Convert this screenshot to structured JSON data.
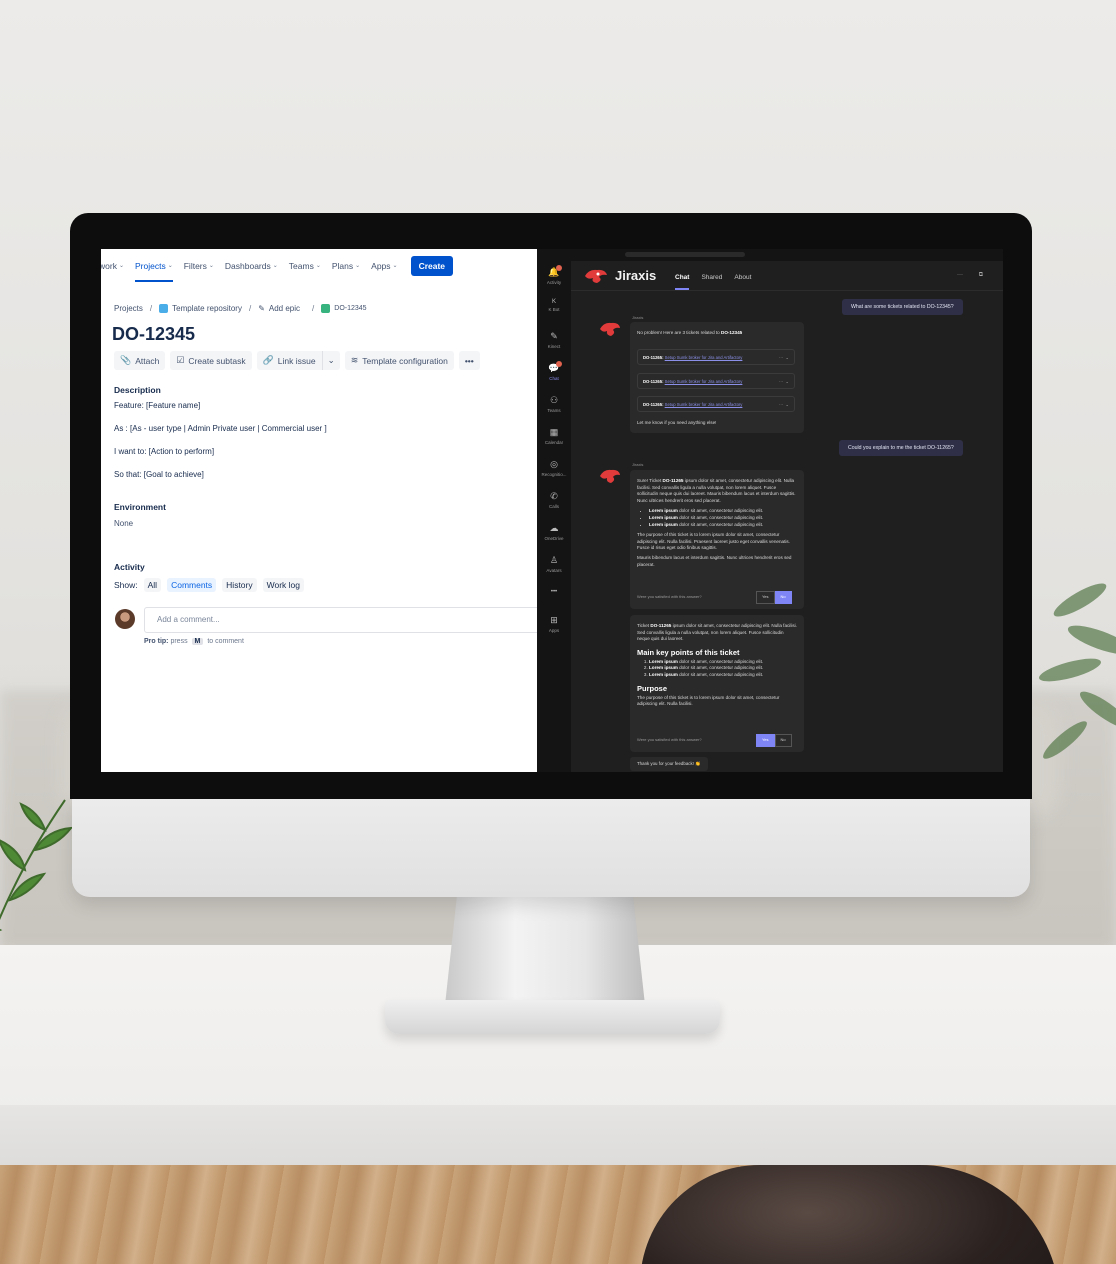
{
  "jira": {
    "nav": [
      {
        "label": "work",
        "active": false
      },
      {
        "label": "Projects",
        "active": true
      },
      {
        "label": "Filters",
        "active": false
      },
      {
        "label": "Dashboards",
        "active": false
      },
      {
        "label": "Teams",
        "active": false
      },
      {
        "label": "Plans",
        "active": false
      },
      {
        "label": "Apps",
        "active": false
      }
    ],
    "create_label": "Create",
    "breadcrumbs": [
      "Projects",
      "Template repository",
      "Add epic",
      "DO-12345"
    ],
    "issue_key": "DO-12345",
    "toolbar": {
      "attach": "Attach",
      "create_subtask": "Create subtask",
      "link_issue": "Link issue",
      "template_configuration": "Template configuration",
      "more": "•••"
    },
    "description": {
      "heading": "Description",
      "lines": [
        "Feature: [Feature name]",
        "As : [As - user type | Admin Private user | Commercial user ]",
        "I want to: [Action to perform]",
        "So that: [Goal to achieve]"
      ]
    },
    "environment": {
      "heading": "Environment",
      "value": "None"
    },
    "activity": {
      "heading": "Activity",
      "show_label": "Show:",
      "filters": [
        {
          "label": "All",
          "selected": false
        },
        {
          "label": "Comments",
          "selected": true
        },
        {
          "label": "History",
          "selected": false
        },
        {
          "label": "Work log",
          "selected": false
        }
      ]
    },
    "comment": {
      "placeholder": "Add a comment...",
      "protip_label": "Pro tip:",
      "protip_press": "press",
      "protip_key": "M",
      "protip_rest": "to comment"
    }
  },
  "teams": {
    "rail": [
      {
        "label": "Activity",
        "glyph": "🔔",
        "badge": true
      },
      {
        "label": "K Bot",
        "glyph": "K",
        "badge": false
      },
      {
        "label": "Kinect",
        "glyph": "✎",
        "badge": false
      },
      {
        "label": "Chat",
        "glyph": "💬",
        "badge": true,
        "active": true
      },
      {
        "label": "Teams",
        "glyph": "⚇",
        "badge": false
      },
      {
        "label": "Calendar",
        "glyph": "▦",
        "badge": false
      },
      {
        "label": "Recognitio...",
        "glyph": "◎",
        "badge": false
      },
      {
        "label": "Calls",
        "glyph": "✆",
        "badge": false
      },
      {
        "label": "OneDrive",
        "glyph": "☁",
        "badge": false
      },
      {
        "label": "Avatars",
        "glyph": "♙",
        "badge": false
      },
      {
        "label": "",
        "glyph": "•••",
        "badge": false
      },
      {
        "label": "Apps",
        "glyph": "⊞",
        "badge": false
      }
    ],
    "app_title": "Jiraxis",
    "tabs": [
      {
        "label": "Chat",
        "active": true
      },
      {
        "label": "Shared",
        "active": false
      },
      {
        "label": "About",
        "active": false
      }
    ],
    "window_controls": [
      "···",
      "⧉"
    ],
    "bot_name": "Jiraxis",
    "user_msg_1": "What are some tickets related to DO-12345?",
    "reply_1": {
      "intro": "No problem! Here are 3 tickets related to",
      "intro_key": "DO-12345",
      "tickets": [
        {
          "id": "DO-11265:",
          "link": "Setup Sumk broker for Jira and Artifactory"
        },
        {
          "id": "DO-11265:",
          "link": "Setup Sumk broker for Jira and Artifactory"
        },
        {
          "id": "DO-11265:",
          "link": "Setup Sumk broker for Jira and Artifactory"
        }
      ],
      "outro": "Let me know if you need anything else!"
    },
    "user_msg_2": "Could you explain to me the ticket DO-11265?",
    "reply_2": {
      "lead": "Sure! Ticket",
      "lead_key": "DO-11265",
      "body": "ipsum dolor sit amet, consectetur adipiscing elit. Nulla facilisi. Sed convallis ligula a nulla volutpat, non lorem aliquet. Fusce sollicitudin neque quis dui laoreet. Mauris bibendum lacus et interdum sagittis. Nunc ultrices hendrerit eros sed placerat.",
      "bullets": [
        {
          "strong": "Lorem ipsum",
          "rest": "dolor sit amet, consectetur adipiscing elit."
        },
        {
          "strong": "Lorem ipsum",
          "rest": "dolor sit amet, consectetur adipiscing elit."
        },
        {
          "strong": "Lorem ipsum",
          "rest": "dolor sit amet, consectetur adipiscing elit."
        }
      ],
      "para2": "The purpose of this ticket is to lorem ipsum dolor sit amet, consectetur adipiscing elit. Nulla facilisi. Praesent laoreet justo eget convallis venenatis. Fusce id risus eget odio finibus sagittis.",
      "para3": "Mauris bibendum lacus et interdum sagittis. Nunc ultrices hendrerit eros sed placerat.",
      "satisfied": "Were you satisfied with this answer?",
      "yes": "Yes",
      "no": "No"
    },
    "card_3": {
      "lead": "Ticket",
      "lead_key": "DO-11265",
      "body": "ipsum dolor sit amet, consectetur adipiscing elit. Nulla facilisi. Sed convallis ligula a nulla volutpat, non lorem aliquet. Fusce sollicitudin neque quis dui laoreet.",
      "h_main": "Main key points of this ticket",
      "points": [
        {
          "strong": "Lorem ipsum",
          "rest": "dolor sit amet, consectetur adipiscing elit."
        },
        {
          "strong": "Lorem ipsum",
          "rest": "dolor sit amet, consectetur adipiscing elit."
        },
        {
          "strong": "Lorem ipsum",
          "rest": "dolor sit amet, consectetur adipiscing elit."
        }
      ],
      "h_purpose": "Purpose",
      "purpose": "The purpose of this ticket is to lorem ipsum dolor sit amet, consectetur adipiscing elit. Nulla facilisi.",
      "satisfied": "Were you satisfied with this answer?",
      "yes": "Yes",
      "no": "No"
    },
    "thanks": "Thank you for your feedback! 👏",
    "accent": "#7f85f5"
  },
  "colors": {
    "jira_blue": "#0052cc",
    "teams_bg": "#1f1f1f",
    "rail_bg": "#141414"
  }
}
